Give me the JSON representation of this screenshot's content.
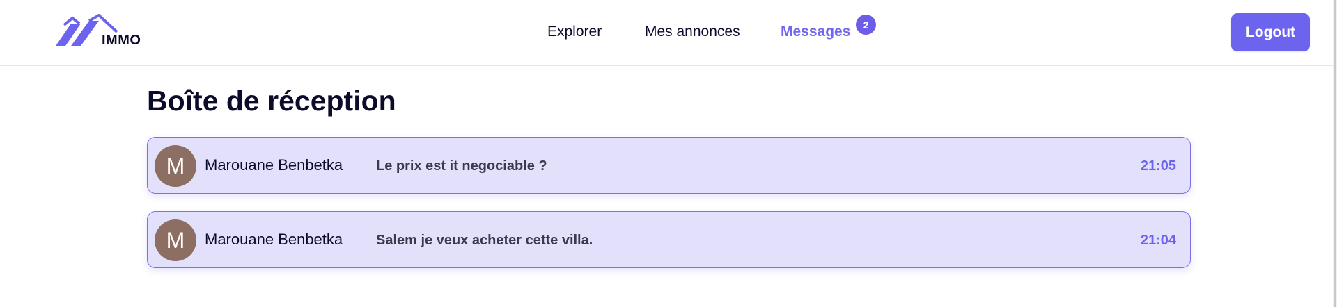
{
  "brand": {
    "name": "IMMO",
    "accent": "#6c63ee"
  },
  "nav": {
    "items": [
      {
        "label": "Explorer"
      },
      {
        "label": "Mes annonces"
      },
      {
        "label": "Messages",
        "badge": "2"
      }
    ]
  },
  "header": {
    "logout_label": "Logout"
  },
  "inbox": {
    "title": "Boîte de réception",
    "messages": [
      {
        "avatar": "M",
        "sender": "Marouane Benbetka",
        "snippet": "Le prix est it negociable ?",
        "time": "21:05"
      },
      {
        "avatar": "M",
        "sender": "Marouane Benbetka",
        "snippet": "Salem je veux acheter cette villa.",
        "time": "21:04"
      }
    ]
  }
}
